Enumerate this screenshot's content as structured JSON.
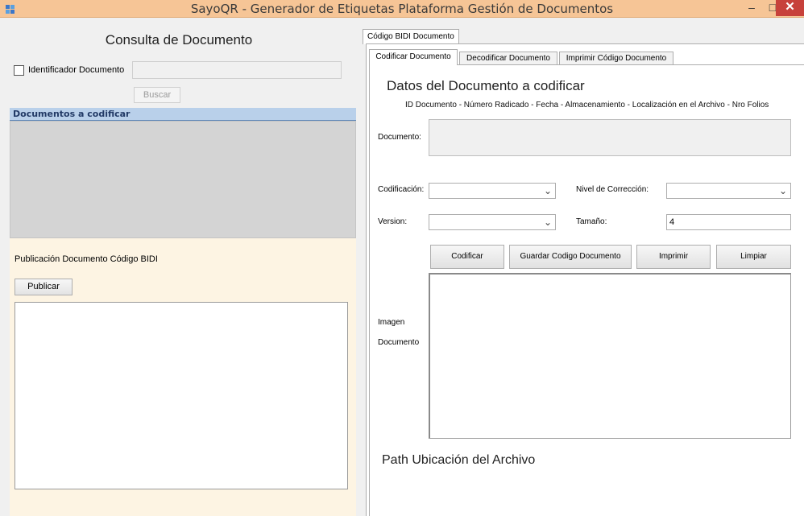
{
  "window": {
    "title": "SayoQR - Generador de Etiquetas Plataforma Gestión de Documentos",
    "minimize_glyph": "–",
    "maximize_glyph": "□",
    "close_glyph": "✕"
  },
  "left": {
    "consulta_title": "Consulta de Documento",
    "checkbox_label": "Identificador Documento",
    "id_value": "",
    "buscar_label": "Buscar",
    "group_header": "Documentos a codificar",
    "publicacion_label": "Publicación Documento Código BIDI",
    "publicar_label": "Publicar",
    "publish_text": ""
  },
  "right": {
    "outer_tab": "Código BIDI Documento",
    "inner_tabs": [
      "Codificar Documento",
      "Decodificar Documento",
      "Imprimir Código Documento"
    ],
    "datos_title": "Datos del Documento a codificar",
    "datos_subtitle": "ID Documento - Número Radicado - Fecha - Almacenamiento - Localización en el Archivo - Nro Folios",
    "documento_label": "Documento:",
    "documento_value": "",
    "codificacion_label": "Codificación:",
    "codificacion_value": "",
    "nivel_label": "Nivel de Corrección:",
    "nivel_value": "",
    "version_label": "Version:",
    "version_value": "",
    "tamano_label": "Tamaño:",
    "tamano_value": "4",
    "buttons": {
      "codificar": "Codificar",
      "guardar": "Guardar Codigo Documento",
      "imprimir": "Imprimir",
      "limpiar": "Limpiar"
    },
    "imagen_label_1": "Imagen",
    "imagen_label_2": "Documento",
    "path_title": "Path Ubicación del Archivo"
  },
  "colors": {
    "titlebar": "#f6c596",
    "close_button": "#c7413b",
    "group_header": "#b9d0ea",
    "publish_area": "#fdf4e3"
  }
}
